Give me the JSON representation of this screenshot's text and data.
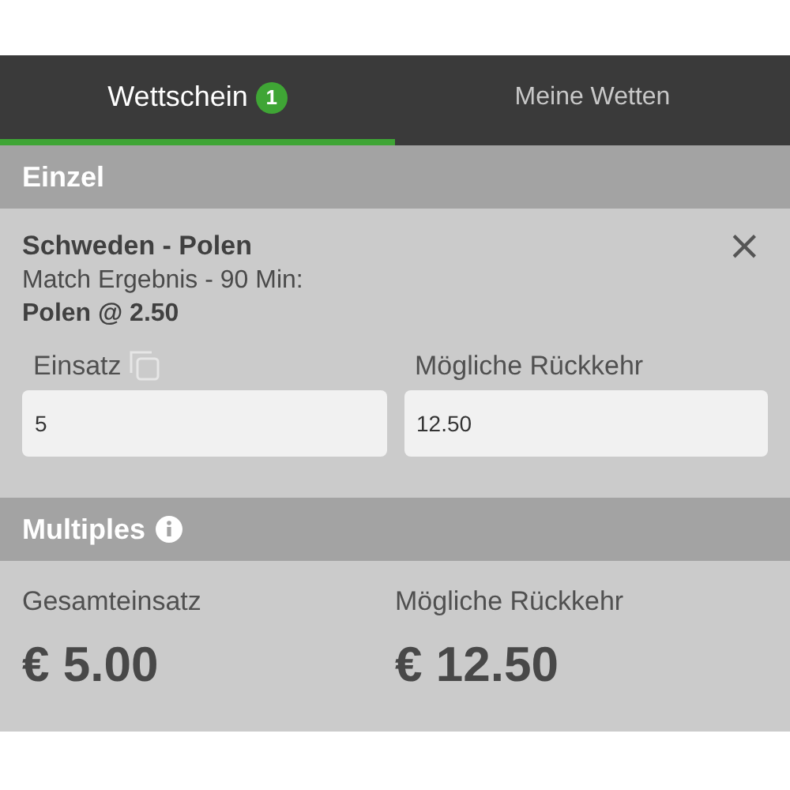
{
  "tabs": [
    {
      "label": "Wettschein",
      "badge": "1",
      "selected": true
    },
    {
      "label": "Meine Wetten",
      "selected": false
    }
  ],
  "single": {
    "title": "Einzel",
    "match": "Schweden - Polen",
    "market": "Match Ergebnis - 90 Min:",
    "pick": "Polen @ 2.50",
    "close": "×",
    "stake": {
      "label": "Einsatz",
      "value": "5"
    },
    "return": {
      "label": "Mögliche Rückkehr",
      "value": "12.50"
    }
  },
  "multiples": {
    "title": "Multiples",
    "total_label": "Gesamteinsatz",
    "total": "€ 5.00",
    "return_label": "Mögliche Rückkehr",
    "return": "€ 12.50"
  }
}
